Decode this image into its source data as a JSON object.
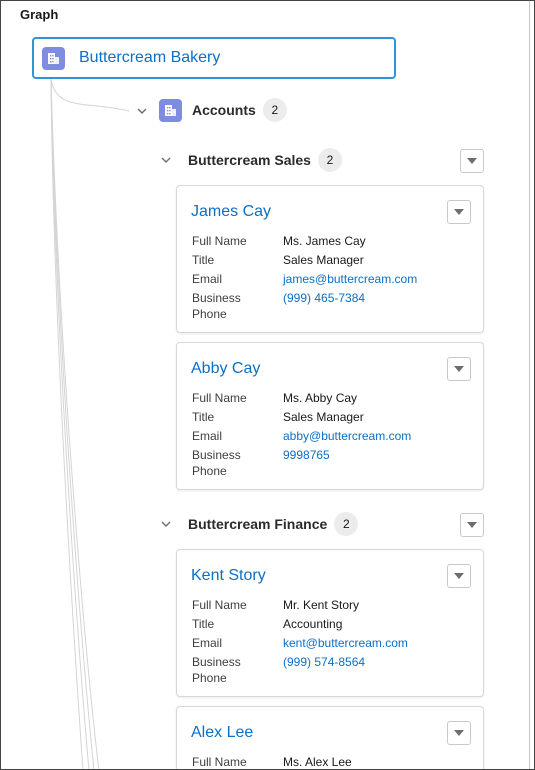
{
  "graph": {
    "title": "Graph"
  },
  "root": {
    "label": "Buttercream Bakery",
    "icon": "building-icon"
  },
  "accounts": {
    "label": "Accounts",
    "count": "2",
    "icon": "building-icon"
  },
  "field_labels": {
    "full_name": "Full Name",
    "title": "Title",
    "email": "Email",
    "business_phone_1": "Business",
    "business_phone_2": "Phone"
  },
  "groups": [
    {
      "label": "Buttercream Sales",
      "count": "2",
      "contacts": [
        {
          "name": "James Cay",
          "full_name": "Ms. James Cay",
          "title": "Sales Manager",
          "email": "james@buttercream.com",
          "phone": "(999) 465-7384"
        },
        {
          "name": "Abby Cay",
          "full_name": "Ms. Abby Cay",
          "title": "Sales Manager",
          "email": "abby@buttercream.com",
          "phone": "9998765"
        }
      ]
    },
    {
      "label": "Buttercream Finance",
      "count": "2",
      "contacts": [
        {
          "name": "Kent Story",
          "full_name": "Mr. Kent Story",
          "title": "Accounting",
          "email": "kent@buttercream.com",
          "phone": "(999) 574-8564"
        },
        {
          "name": "Alex Lee",
          "full_name": "Ms. Alex Lee"
        }
      ]
    }
  ],
  "colors": {
    "link": "#0b6fc6",
    "selected_border": "#2f95d8",
    "icon_bg": "#7f8de1"
  }
}
